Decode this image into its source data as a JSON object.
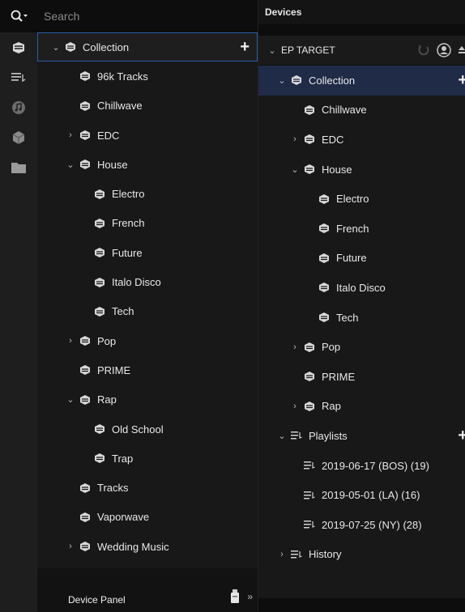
{
  "search": {
    "placeholder": "Search"
  },
  "rail": [
    {
      "name": "crate-rail-icon",
      "active": true
    },
    {
      "name": "playlist-rail-icon"
    },
    {
      "name": "music-note-rail-icon"
    },
    {
      "name": "box-rail-icon"
    },
    {
      "name": "folder-rail-icon"
    }
  ],
  "collection": {
    "label": "Collection",
    "add_label": "+",
    "items": [
      {
        "label": "96k Tracks",
        "level": 1,
        "expand": "none"
      },
      {
        "label": "Chillwave",
        "level": 1,
        "expand": "none"
      },
      {
        "label": "EDC",
        "level": 1,
        "expand": "collapsed"
      },
      {
        "label": "House",
        "level": 1,
        "expand": "expanded"
      },
      {
        "label": "Electro",
        "level": 2,
        "expand": "none"
      },
      {
        "label": "French",
        "level": 2,
        "expand": "none"
      },
      {
        "label": "Future",
        "level": 2,
        "expand": "none"
      },
      {
        "label": "Italo Disco",
        "level": 2,
        "expand": "none"
      },
      {
        "label": "Tech",
        "level": 2,
        "expand": "none"
      },
      {
        "label": "Pop",
        "level": 1,
        "expand": "collapsed"
      },
      {
        "label": "PRIME",
        "level": 1,
        "expand": "none"
      },
      {
        "label": "Rap",
        "level": 1,
        "expand": "expanded"
      },
      {
        "label": "Old School",
        "level": 2,
        "expand": "none"
      },
      {
        "label": "Trap",
        "level": 2,
        "expand": "none"
      },
      {
        "label": "Tracks",
        "level": 1,
        "expand": "none"
      },
      {
        "label": "Vaporwave",
        "level": 1,
        "expand": "none"
      },
      {
        "label": "Wedding Music",
        "level": 1,
        "expand": "collapsed"
      }
    ]
  },
  "bottom": {
    "device_panel_label": "Device Panel",
    "expand_label": "»"
  },
  "devices": {
    "title": "Devices",
    "device_name": "EP TARGET",
    "collection_label": "Collection",
    "collection_items": [
      {
        "label": "Chillwave",
        "level": 1,
        "expand": "none"
      },
      {
        "label": "EDC",
        "level": 1,
        "expand": "collapsed"
      },
      {
        "label": "House",
        "level": 1,
        "expand": "expanded"
      },
      {
        "label": "Electro",
        "level": 2,
        "expand": "none"
      },
      {
        "label": "French",
        "level": 2,
        "expand": "none"
      },
      {
        "label": "Future",
        "level": 2,
        "expand": "none"
      },
      {
        "label": "Italo Disco",
        "level": 2,
        "expand": "none"
      },
      {
        "label": "Tech",
        "level": 2,
        "expand": "none"
      },
      {
        "label": "Pop",
        "level": 1,
        "expand": "collapsed"
      },
      {
        "label": "PRIME",
        "level": 1,
        "expand": "none"
      },
      {
        "label": "Rap",
        "level": 1,
        "expand": "collapsed"
      }
    ],
    "playlists_label": "Playlists",
    "playlists": [
      "2019-06-17 (BOS) (19)",
      "2019-05-01 (LA) (16)",
      "2019-07-25 (NY) (28)"
    ],
    "history_label": "History"
  },
  "colors": {
    "selection_border": "#2a5ea8",
    "selection_fill": "#1f2b47",
    "panel": "#181818",
    "rail": "#1e1e1e"
  }
}
